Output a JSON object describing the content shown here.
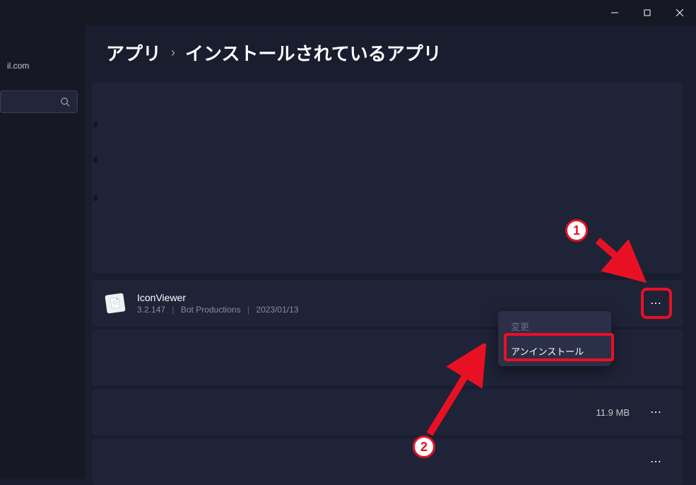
{
  "titlebar": {
    "minimize_label": "minimize",
    "maximize_label": "maximize",
    "close_label": "close"
  },
  "breadcrumb": {
    "root": "アプリ",
    "current": "インストールされているアプリ"
  },
  "sidebar": {
    "email_fragment": "il.com"
  },
  "app_row": {
    "name": "IconViewer",
    "version": "3.2.147",
    "publisher": "Bot Productions",
    "install_date": "2023/01/13"
  },
  "context_menu": {
    "modify": "変更",
    "uninstall": "アンインストール"
  },
  "other_rows": {
    "size_1": "11.9 MB"
  },
  "annotations": {
    "step1": "1",
    "step2": "2"
  }
}
